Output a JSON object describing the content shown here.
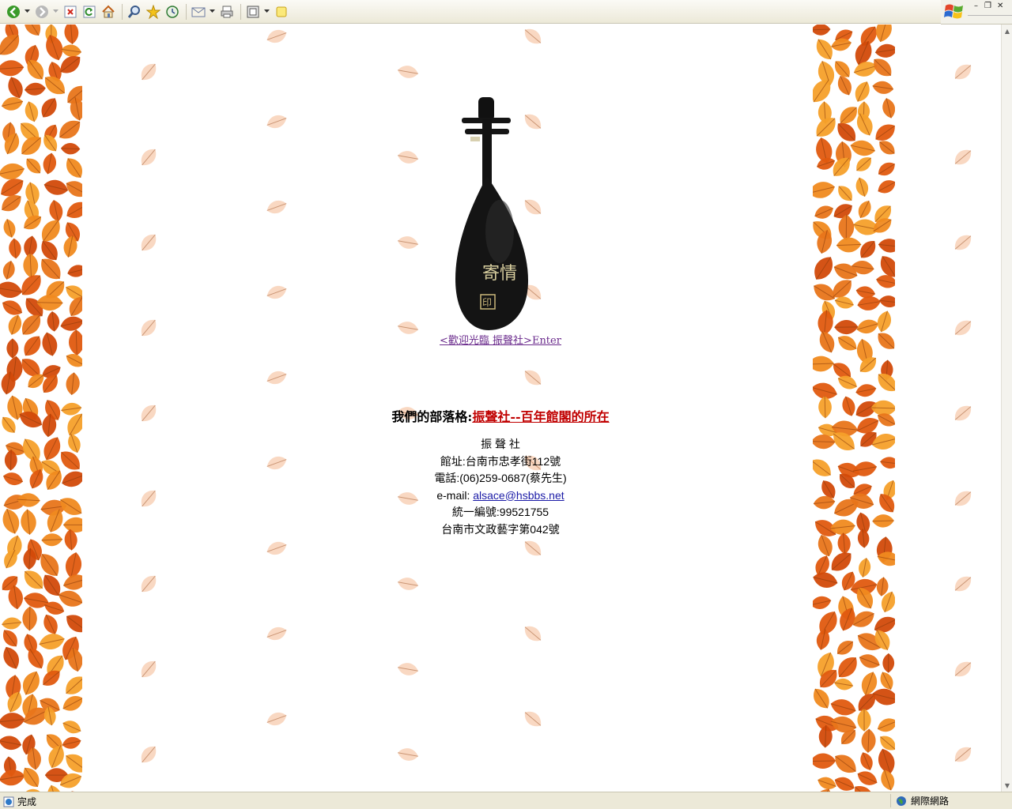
{
  "toolbar": {
    "buttons": [
      "back-icon",
      "forward-icon",
      "stop-icon",
      "refresh-icon",
      "home-icon",
      "search-icon",
      "favorites-icon",
      "history-icon",
      "mail-icon",
      "print-icon",
      "edit-icon",
      "note-icon"
    ]
  },
  "page": {
    "enter_link": "<歡迎光臨  振聲社>Enter",
    "blog_prefix": "我們的部落格:",
    "blog_link": "振聲社--百年館閣的所在",
    "org_name": "振 聲 社",
    "address": "館址:台南市忠孝街112號",
    "phone": "電話:(06)259-0687(蔡先生)",
    "email_prefix": "e-mail: ",
    "email": "alsace@hsbbs.net",
    "tax_id": "統一編號:99521755",
    "registration": "台南市文政藝字第042號"
  },
  "pipa_text": {
    "main": "寄情",
    "small": "印"
  },
  "statusbar": {
    "status": "完成",
    "zone": "網際網路"
  },
  "colors": {
    "leaf_orange": "#e8751a",
    "leaf_pale": "#f6c7a8",
    "link_blog": "#c00000",
    "link_enter": "#6a2a8c",
    "link_mail": "#1a1aa6"
  }
}
